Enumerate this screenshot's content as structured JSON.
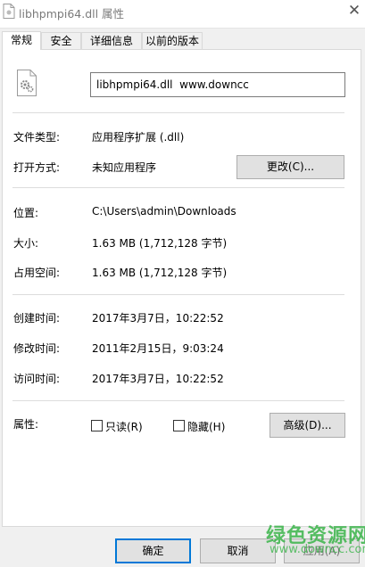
{
  "window": {
    "title": "libhpmpi64.dll 属性",
    "close_glyph": "✕"
  },
  "tabs": [
    {
      "label": "常规",
      "active": true
    },
    {
      "label": "安全",
      "active": false
    },
    {
      "label": "详细信息",
      "active": false
    },
    {
      "label": "以前的版本",
      "active": false
    }
  ],
  "general": {
    "file_name": "libhpmpi64.dll  www.downcc",
    "file_type_label": "文件类型:",
    "file_type_value": "应用程序扩展 (.dll)",
    "opens_with_label": "打开方式:",
    "opens_with_value": "未知应用程序",
    "change_button": "更改(C)...",
    "location_label": "位置:",
    "location_value": "C:\\Users\\admin\\Downloads",
    "size_label": "大小:",
    "size_value": "1.63 MB (1,712,128 字节)",
    "size_on_disk_label": "占用空间:",
    "size_on_disk_value": "1.63 MB (1,712,128 字节)",
    "created_label": "创建时间:",
    "created_value": "2017年3月7日，10:22:52",
    "modified_label": "修改时间:",
    "modified_value": "2011年2月15日，9:03:24",
    "accessed_label": "访问时间:",
    "accessed_value": "2017年3月7日，10:22:52",
    "attributes_label": "属性:",
    "readonly_label": "只读(R)",
    "readonly_checked": false,
    "hidden_label": "隐藏(H)",
    "hidden_checked": false,
    "advanced_button": "高级(D)..."
  },
  "footer": {
    "ok_button": "确定",
    "cancel_button": "取消",
    "apply_button": "应用(A)"
  },
  "watermark": {
    "text": "绿色资源网",
    "url": "www.downcc.com"
  },
  "colors": {
    "focus_accent": "#0078d7",
    "watermark": "#3bb54a"
  }
}
